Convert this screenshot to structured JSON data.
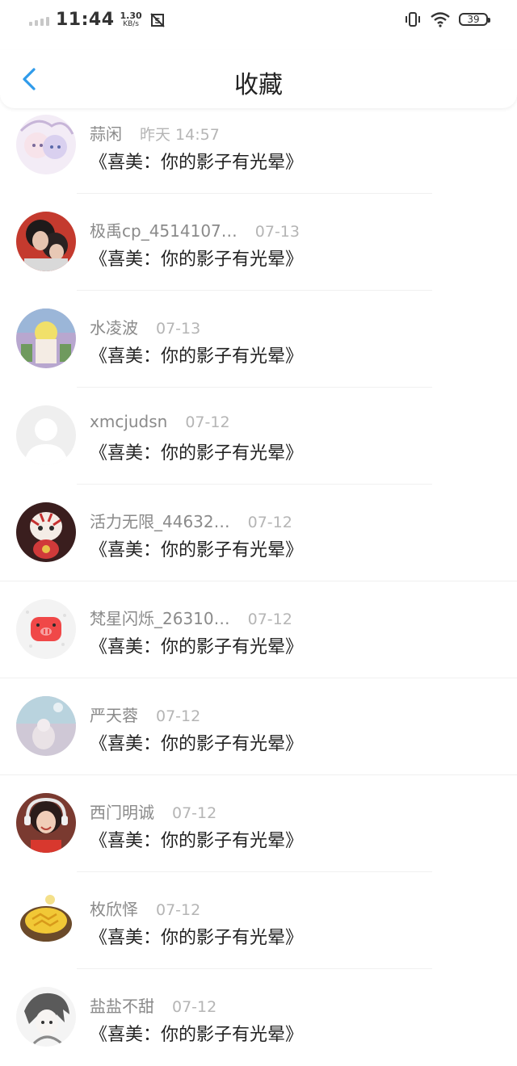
{
  "status_bar": {
    "time": "11:44",
    "net_speed_value": "1.30",
    "net_speed_unit": "KB/s",
    "battery": "39"
  },
  "header": {
    "title": "收藏"
  },
  "favorites": [
    {
      "username": "蒜闲",
      "date": "昨天 14:57",
      "content": "《喜美：你的影子有光晕》",
      "avatar_color": "#e9d6f0"
    },
    {
      "username": "极禹cp_4514107…",
      "date": "07-13",
      "content": "《喜美：你的影子有光晕》",
      "avatar_color": "#3a2525"
    },
    {
      "username": "水凌波",
      "date": "07-13",
      "content": "《喜美：你的影子有光晕》",
      "avatar_color": "#c9a9c9"
    },
    {
      "username": "xmcjudsn",
      "date": "07-12",
      "content": "《喜美：你的影子有光晕》",
      "avatar_color": "#eeeeee"
    },
    {
      "username": "活力无限_44632…",
      "date": "07-12",
      "content": "《喜美：你的影子有光晕》",
      "avatar_color": "#7a2a2a"
    },
    {
      "username": "梵星闪烁_26310…",
      "date": "07-12",
      "content": "《喜美：你的影子有光晕》",
      "avatar_color": "#f2f2f2"
    },
    {
      "username": "严天蓉",
      "date": "07-12",
      "content": "《喜美：你的影子有光晕》",
      "avatar_color": "#c8c0cf"
    },
    {
      "username": "西门明诚",
      "date": "07-12",
      "content": "《喜美：你的影子有光晕》",
      "avatar_color": "#8a4a3a"
    },
    {
      "username": "枚欣怿",
      "date": "07-12",
      "content": "《喜美：你的影子有光晕》",
      "avatar_color": "#d8b24a"
    },
    {
      "username": "盐盐不甜",
      "date": "07-12",
      "content": "《喜美：你的影子有光晕》",
      "avatar_color": "#dcdcdc"
    }
  ]
}
